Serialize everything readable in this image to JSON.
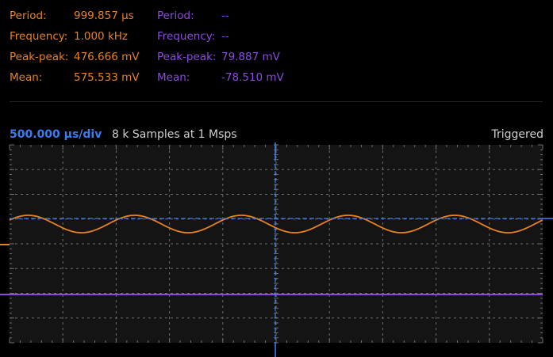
{
  "ch1": {
    "color": "#e8821f",
    "period_label": "Period:",
    "period_value": "999.857 µs",
    "frequency_label": "Frequency:",
    "frequency_value": "1.000 kHz",
    "peak_label": "Peak-peak:",
    "peak_value": "476.666 mV",
    "mean_label": "Mean:",
    "mean_value": "575.533 mV"
  },
  "ch2": {
    "color": "#8a4be0",
    "period_label": "Period:",
    "period_value": "--",
    "frequency_label": "Frequency:",
    "frequency_value": "--",
    "peak_label": "Peak-peak:",
    "peak_value": "79.887 mV",
    "mean_label": "Mean:",
    "mean_value": "-78.510 mV"
  },
  "scope": {
    "timebase": "500.000 µs/div",
    "samples": "8 k Samples at 1 Msps",
    "status": "Triggered",
    "grid_color": "#6e6e6e",
    "cursor_color": "#3d7bf0",
    "background": "#141414"
  }
}
